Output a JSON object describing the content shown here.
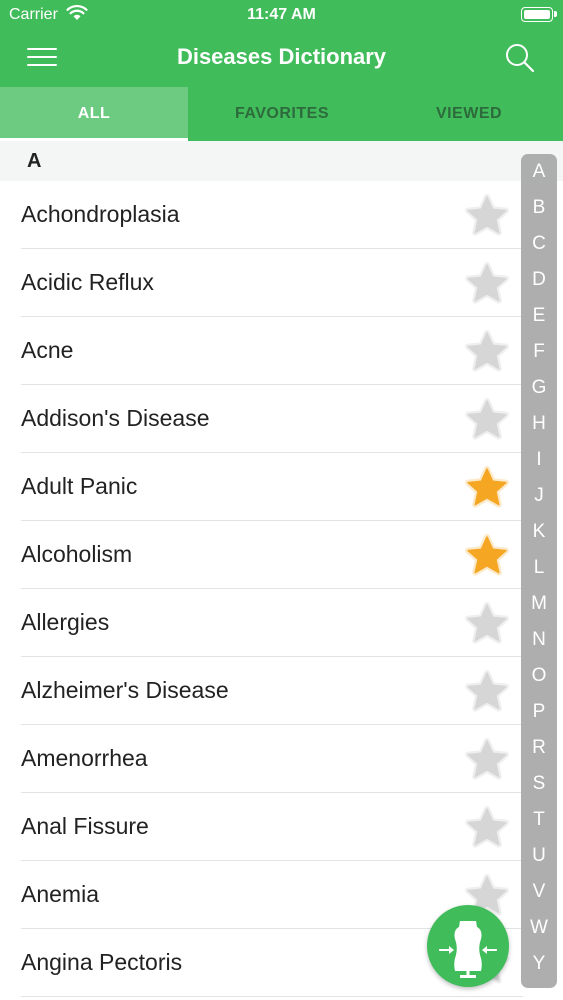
{
  "status_bar": {
    "carrier": "Carrier",
    "time": "11:47 AM"
  },
  "header": {
    "title": "Diseases Dictionary",
    "menu_icon": "hamburger-menu-icon",
    "search_icon": "search-icon"
  },
  "tabs": [
    {
      "label": "ALL",
      "active": true
    },
    {
      "label": "FAVORITES",
      "active": false
    },
    {
      "label": "VIEWED",
      "active": false
    }
  ],
  "section": {
    "letter": "A"
  },
  "items": [
    {
      "label": "Achondroplasia",
      "favorite": false
    },
    {
      "label": "Acidic Reflux",
      "favorite": false
    },
    {
      "label": "Acne",
      "favorite": false
    },
    {
      "label": "Addison's Disease",
      "favorite": false
    },
    {
      "label": "Adult Panic",
      "favorite": true
    },
    {
      "label": "Alcoholism",
      "favorite": true
    },
    {
      "label": "Allergies",
      "favorite": false
    },
    {
      "label": "Alzheimer's Disease",
      "favorite": false
    },
    {
      "label": "Amenorrhea",
      "favorite": false
    },
    {
      "label": "Anal Fissure",
      "favorite": false
    },
    {
      "label": "Anemia",
      "favorite": false
    },
    {
      "label": "Angina Pectoris",
      "favorite": false
    }
  ],
  "index_letters": [
    "A",
    "B",
    "C",
    "D",
    "E",
    "F",
    "G",
    "H",
    "I",
    "J",
    "K",
    "L",
    "M",
    "N",
    "O",
    "P",
    "R",
    "S",
    "T",
    "U",
    "V",
    "W",
    "Y"
  ],
  "colors": {
    "brand_green": "#41bc5b",
    "tab_active": "#6ccb80",
    "star_active": "#f5a623",
    "star_inactive": "#d6d6d6"
  },
  "fab": {
    "icon": "body-measure-icon"
  }
}
